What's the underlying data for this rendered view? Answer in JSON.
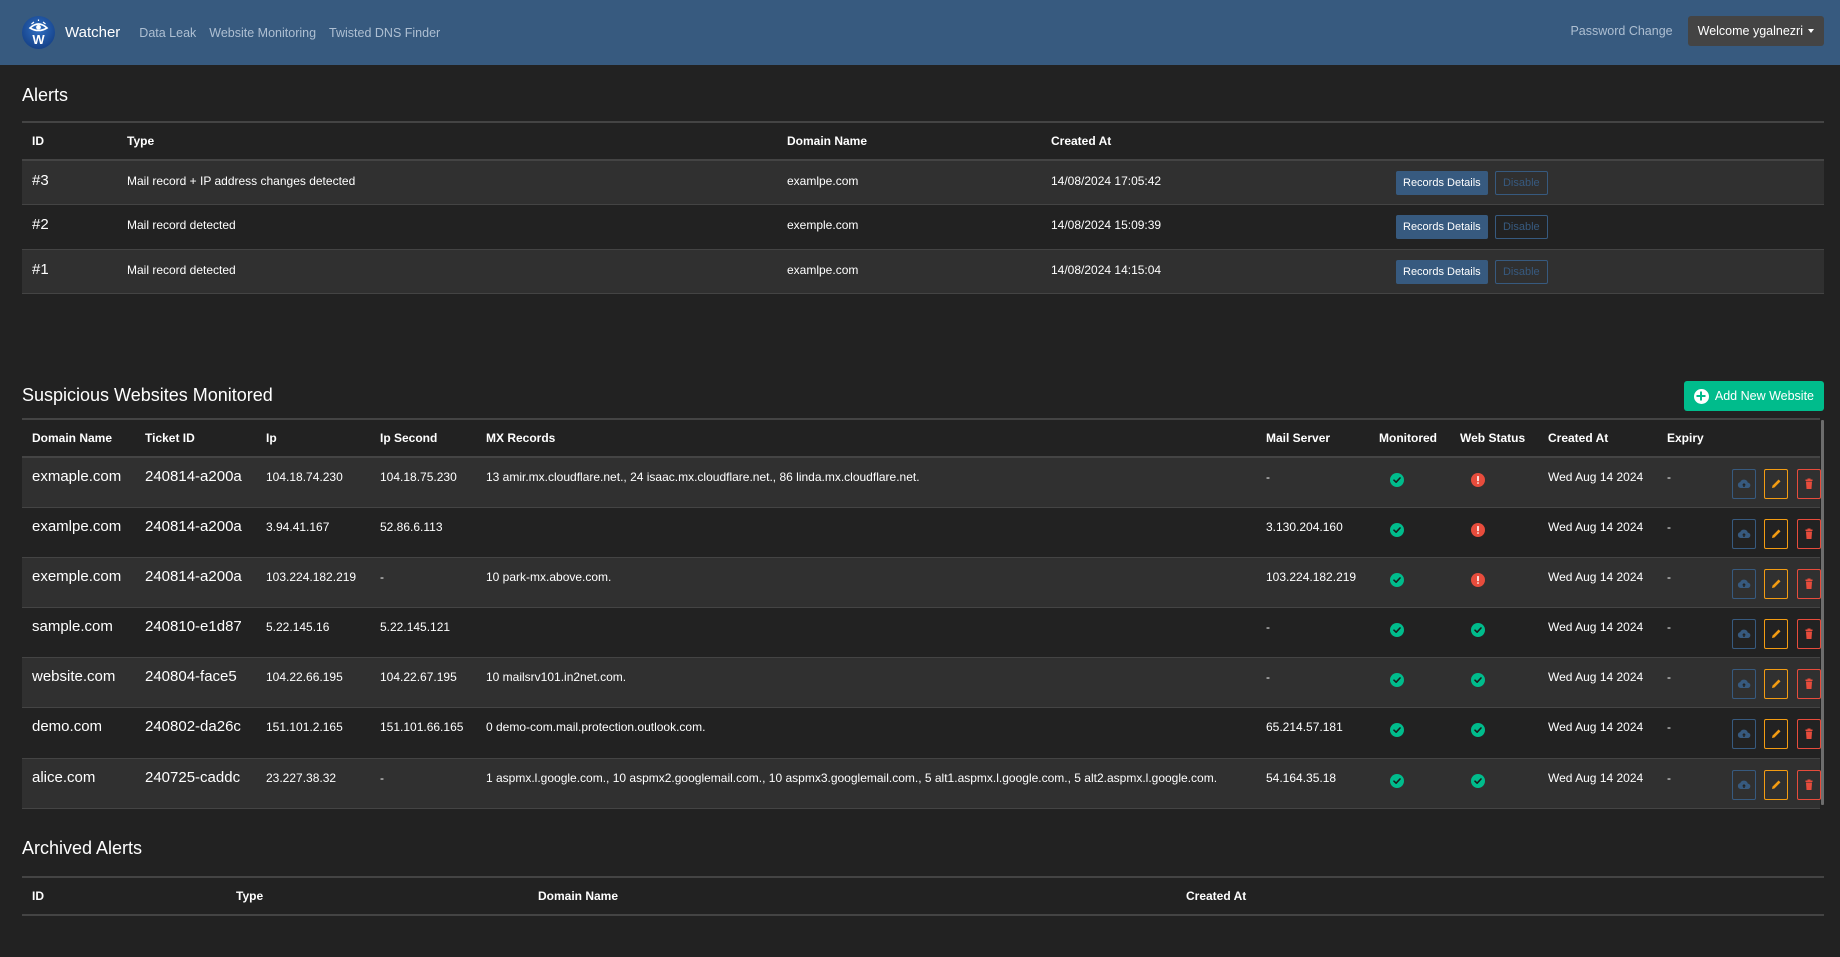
{
  "navbar": {
    "brand": "Watcher",
    "links": [
      "Data Leak",
      "Website Monitoring",
      "Twisted DNS Finder"
    ],
    "password_change": "Password Change",
    "user_menu": "Welcome ygalnezri",
    "colors": {
      "background": "#375a7f"
    }
  },
  "alerts": {
    "title": "Alerts",
    "columns": [
      "ID",
      "Type",
      "Domain Name",
      "Created At",
      ""
    ],
    "rows": [
      {
        "id": "#3",
        "type": "Mail record + IP address changes detected",
        "domain": "examlpe.com",
        "created_at": "14/08/2024 17:05:42",
        "records_label": "Records Details",
        "disable_label": "Disable"
      },
      {
        "id": "#2",
        "type": "Mail record detected",
        "domain": "exemple.com",
        "created_at": "14/08/2024 15:09:39",
        "records_label": "Records Details",
        "disable_label": "Disable"
      },
      {
        "id": "#1",
        "type": "Mail record detected",
        "domain": "examlpe.com",
        "created_at": "14/08/2024 14:15:04",
        "records_label": "Records Details",
        "disable_label": "Disable"
      }
    ]
  },
  "websites": {
    "title": "Suspicious Websites Monitored",
    "add_button": "Add New Website",
    "columns": [
      "Domain Name",
      "Ticket ID",
      "Ip",
      "Ip Second",
      "MX Records",
      "Mail Server",
      "Monitored",
      "Web Status",
      "Created At",
      "Expiry",
      ""
    ],
    "rows": [
      {
        "domain": "exmaple.com",
        "ticket": "240814-a200a",
        "ip": "104.18.74.230",
        "ip2": "104.18.75.230",
        "mx": "13 amir.mx.cloudflare.net., 24 isaac.mx.cloudflare.net., 86 linda.mx.cloudflare.net.",
        "mail_server": "-",
        "monitored": "ok",
        "web_status": "error",
        "created_at": "Wed Aug 14 2024",
        "expiry": "-"
      },
      {
        "domain": "examlpe.com",
        "ticket": "240814-a200a",
        "ip": "3.94.41.167",
        "ip2": "52.86.6.113",
        "mx": "",
        "mail_server": "3.130.204.160",
        "monitored": "ok",
        "web_status": "error",
        "created_at": "Wed Aug 14 2024",
        "expiry": "-"
      },
      {
        "domain": "exemple.com",
        "ticket": "240814-a200a",
        "ip": "103.224.182.219",
        "ip2": "-",
        "mx": "10 park-mx.above.com.",
        "mail_server": "103.224.182.219",
        "monitored": "ok",
        "web_status": "error",
        "created_at": "Wed Aug 14 2024",
        "expiry": "-"
      },
      {
        "domain": "sample.com",
        "ticket": "240810-e1d87",
        "ip": "5.22.145.16",
        "ip2": "5.22.145.121",
        "mx": "",
        "mail_server": "-",
        "monitored": "ok",
        "web_status": "ok",
        "created_at": "Wed Aug 14 2024",
        "expiry": "-"
      },
      {
        "domain": "website.com",
        "ticket": "240804-face5",
        "ip": "104.22.66.195",
        "ip2": "104.22.67.195",
        "mx": "10 mailsrv101.in2net.com.",
        "mail_server": "-",
        "monitored": "ok",
        "web_status": "ok",
        "created_at": "Wed Aug 14 2024",
        "expiry": "-"
      },
      {
        "domain": "demo.com",
        "ticket": "240802-da26c",
        "ip": "151.101.2.165",
        "ip2": "151.101.66.165",
        "mx": "0 demo-com.mail.protection.outlook.com.",
        "mail_server": "65.214.57.181",
        "monitored": "ok",
        "web_status": "ok",
        "created_at": "Wed Aug 14 2024",
        "expiry": "-"
      },
      {
        "domain": "alice.com",
        "ticket": "240725-caddc",
        "ip": "23.227.38.32",
        "ip2": "-",
        "mx": "1 aspmx.l.google.com., 10 aspmx2.googlemail.com., 10 aspmx3.googlemail.com., 5 alt1.aspmx.l.google.com., 5 alt2.aspmx.l.google.com.",
        "mail_server": "54.164.35.18",
        "monitored": "ok",
        "web_status": "ok",
        "created_at": "Wed Aug 14 2024",
        "expiry": "-"
      }
    ],
    "row_actions": [
      "cloud-upload-icon",
      "pencil-icon",
      "trash-icon"
    ],
    "colors": {
      "ok": "#00bc8c",
      "error": "#e74c3c",
      "primary": "#375a7f",
      "warning": "#f39c12"
    }
  },
  "archived": {
    "title": "Archived Alerts",
    "columns": [
      "ID",
      "Type",
      "Domain Name",
      "Created At"
    ]
  }
}
